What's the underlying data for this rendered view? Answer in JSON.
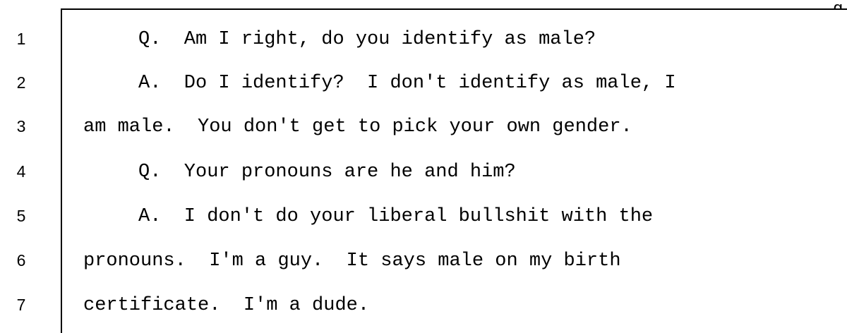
{
  "transcript": {
    "corner_fragment": "g",
    "lines": [
      {
        "number": "1",
        "text": "Q.  Am I right, do you identify as male?"
      },
      {
        "number": "2",
        "text": "A.  Do I identify?  I don't identify as male, I"
      },
      {
        "number": "3",
        "text": "am male.  You don't get to pick your own gender."
      },
      {
        "number": "4",
        "text": "Q.  Your pronouns are he and him?"
      },
      {
        "number": "5",
        "text": "A.  I don't do your liberal bullshit with the"
      },
      {
        "number": "6",
        "text": "pronouns.  I'm a guy.  It says male on my birth"
      },
      {
        "number": "7",
        "text": "certificate.  I'm a dude."
      }
    ]
  }
}
